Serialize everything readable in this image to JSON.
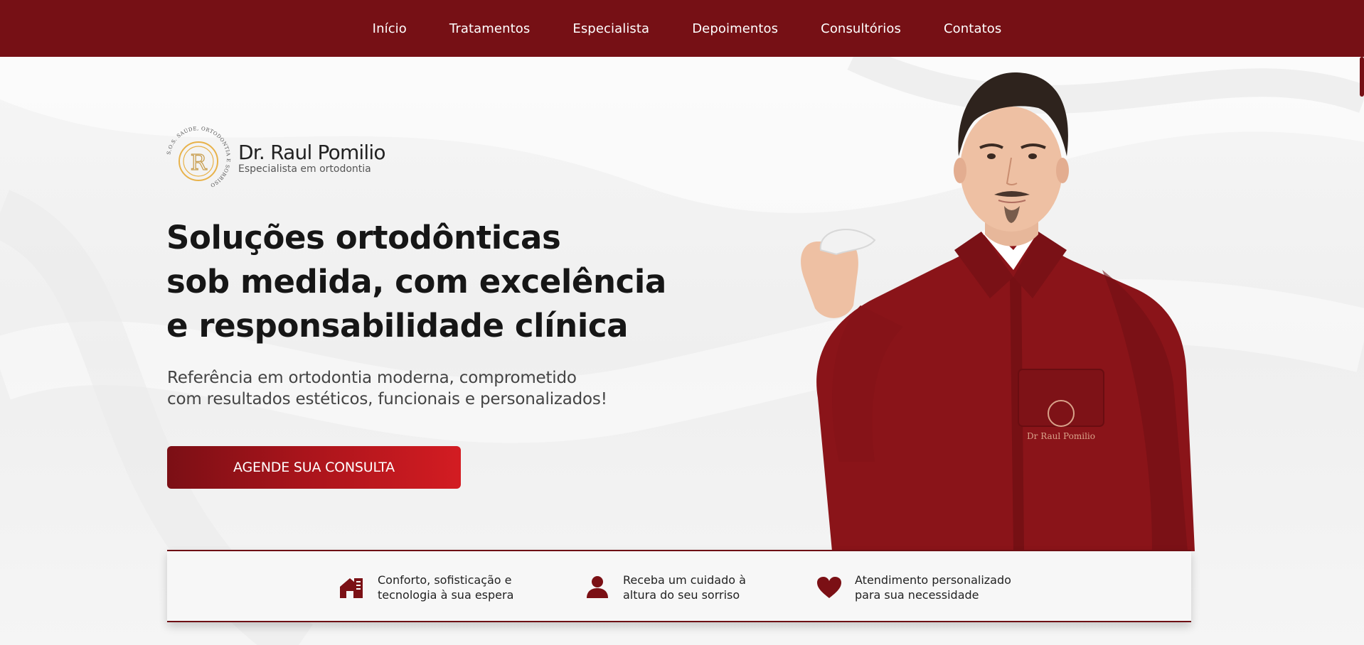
{
  "nav": {
    "items": [
      {
        "label": "Início"
      },
      {
        "label": "Tratamentos"
      },
      {
        "label": "Especialista"
      },
      {
        "label": "Depoimentos"
      },
      {
        "label": "Consultórios"
      },
      {
        "label": "Contatos"
      }
    ]
  },
  "brand": {
    "logo_ring_text": "S.O.S. SAÚDE, ORTODONTIA E SORRISO",
    "logo_letter": "R",
    "name": "Dr. Raul Pomilio",
    "subtitle": "Especialista em ortodontia"
  },
  "hero": {
    "headline_lines": [
      "Soluções ortodônticas",
      "sob medida, com excelência",
      "e responsabilidade clínica"
    ],
    "lead_lines": [
      "Referência em ortodontia moderna, comprometido",
      "com resultados estéticos, funcionais e personalizados!"
    ],
    "cta_label": "AGENDE SUA CONSULTA",
    "jacket_embroidery": "Dr Raul Pomilio"
  },
  "features": [
    {
      "icon": "clinic-building-icon",
      "lines": [
        "Conforto, sofisticação e",
        "tecnologia à sua espera"
      ]
    },
    {
      "icon": "person-icon",
      "lines": [
        "Receba um cuidado à",
        "altura do seu sorriso"
      ]
    },
    {
      "icon": "heart-icon",
      "lines": [
        "Atendimento personalizado",
        "para sua necessidade"
      ]
    }
  ],
  "colors": {
    "brand_red": "#761015",
    "cta_gradient_start": "#7b0f15",
    "cta_gradient_end": "#d31c22",
    "logo_gold": "#e8b24a",
    "headline": "#161616"
  }
}
